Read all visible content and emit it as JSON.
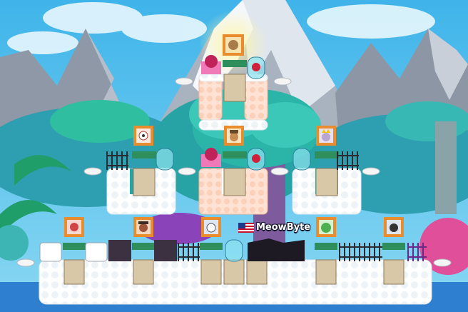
{
  "world": {
    "player": {
      "name": "MeowByte",
      "flag": "us-flag-icon"
    }
  },
  "palette": {
    "sky": "#5ec3ec",
    "mountain": "#9fa7b3",
    "snow": "#f4f7fb",
    "foliage": "#3db5b5",
    "cloud_block": "#ffffff",
    "pink_block": "#ffd7c2",
    "frame_orange": "#e98c2d",
    "fence": "#2a2a33",
    "pink_bush": "#e0509a"
  }
}
